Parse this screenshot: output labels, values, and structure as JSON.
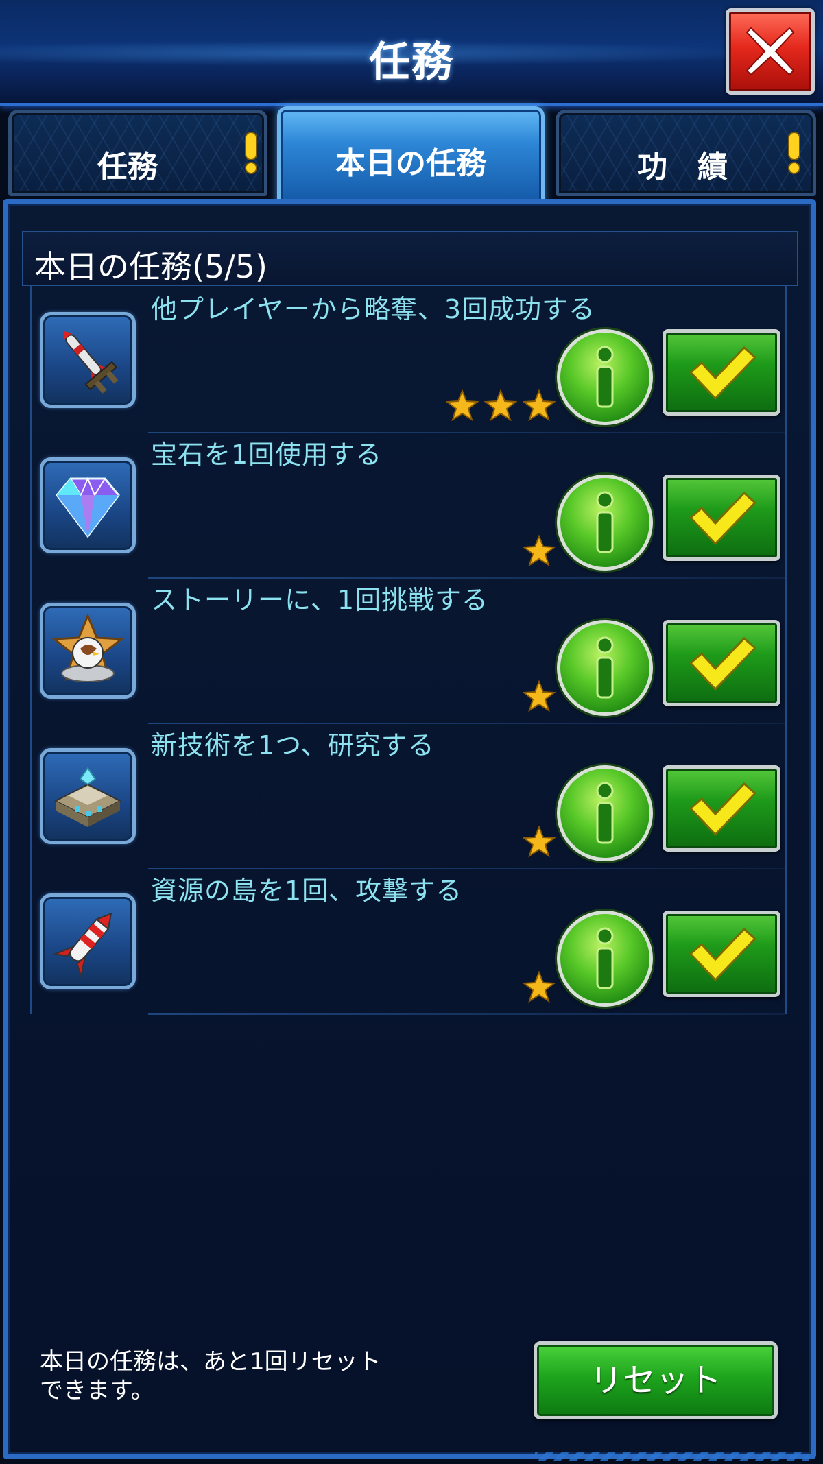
{
  "header": {
    "title": "任務",
    "close_icon": "close-x-icon"
  },
  "tabs": [
    {
      "label": "任務",
      "active": false,
      "alert": true
    },
    {
      "label": "本日の任務",
      "active": true,
      "alert": false
    },
    {
      "label": "功　績",
      "active": false,
      "alert": true
    }
  ],
  "section": {
    "title": "本日の任務(5/5)"
  },
  "missions": [
    {
      "text": "他プレイヤーから略奪、3回成功する",
      "icon": "missile-launcher-icon",
      "stars": 3
    },
    {
      "text": "宝石を1回使用する",
      "icon": "gem-icon",
      "stars": 1
    },
    {
      "text": "ストーリーに、1回挑戦する",
      "icon": "eagle-star-badge-icon",
      "stars": 1
    },
    {
      "text": "新技術を1つ、研究する",
      "icon": "research-building-icon",
      "stars": 1
    },
    {
      "text": "資源の島を1回、攻撃する",
      "icon": "rocket-icon",
      "stars": 1
    }
  ],
  "footer": {
    "note_line1": "本日の任務は、あと1回リセット",
    "note_line2": "できます。",
    "reset_label": "リセット"
  },
  "colors": {
    "mission_text": "#8de2f0",
    "accent_blue": "#2c6bc4",
    "button_green": "#1ea51d",
    "close_red": "#e4281c",
    "star_gold": "#f5b81a"
  }
}
